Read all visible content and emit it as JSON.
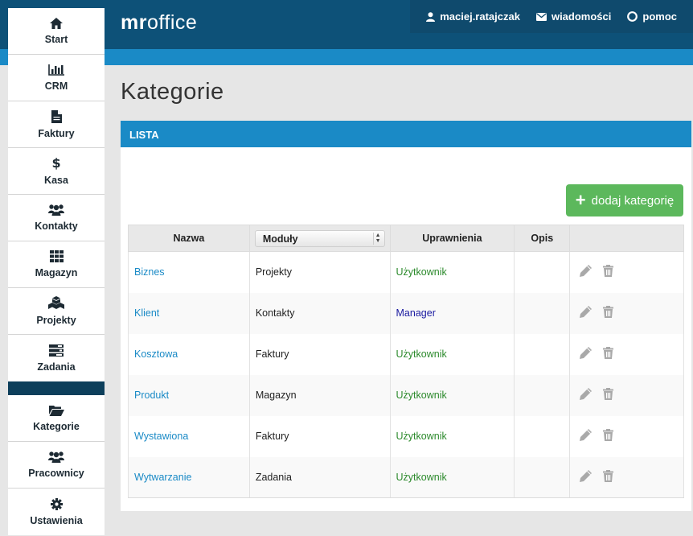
{
  "brand": {
    "bold": "mr",
    "rest": "office"
  },
  "usermenu": [
    {
      "label": "maciej.ratajczak",
      "icon": "user-icon"
    },
    {
      "label": "wiadomości",
      "icon": "envelope-icon"
    },
    {
      "label": "pomoc",
      "icon": "lifebuoy-icon"
    }
  ],
  "sidebar": {
    "items": [
      {
        "label": "Start",
        "icon": "home-icon"
      },
      {
        "label": "CRM",
        "icon": "bar-chart-icon"
      },
      {
        "label": "Faktury",
        "icon": "file-icon"
      },
      {
        "label": "Kasa",
        "icon": "dollar-icon"
      },
      {
        "label": "Kontakty",
        "icon": "group-icon"
      },
      {
        "label": "Magazyn",
        "icon": "grid-icon"
      },
      {
        "label": "Projekty",
        "icon": "cubes-icon"
      },
      {
        "label": "Zadania",
        "icon": "tasks-icon"
      }
    ],
    "bottom_items": [
      {
        "label": "Kategorie",
        "icon": "folder-open-icon"
      },
      {
        "label": "Pracownicy",
        "icon": "group-icon"
      },
      {
        "label": "Ustawienia",
        "icon": "gear-icon"
      }
    ]
  },
  "page": {
    "title": "Kategorie"
  },
  "panel": {
    "title": "LISTA",
    "add_button": "dodaj kategorię"
  },
  "table": {
    "headers": {
      "name": "Nazwa",
      "modules": "Moduły",
      "permissions": "Uprawnienia",
      "description": "Opis"
    },
    "rows": [
      {
        "name": "Biznes",
        "module": "Projekty",
        "permission": "Użytkownik",
        "description": ""
      },
      {
        "name": "Klient",
        "module": "Kontakty",
        "permission": "Manager",
        "description": ""
      },
      {
        "name": "Kosztowa",
        "module": "Faktury",
        "permission": "Użytkownik",
        "description": ""
      },
      {
        "name": "Produkt",
        "module": "Magazyn",
        "permission": "Użytkownik",
        "description": ""
      },
      {
        "name": "Wystawiona",
        "module": "Faktury",
        "permission": "Użytkownik",
        "description": ""
      },
      {
        "name": "Wytwarzanie",
        "module": "Zadania",
        "permission": "Użytkownik",
        "description": ""
      }
    ]
  },
  "colors": {
    "header_dark": "#0d5178",
    "header_light": "#1a8ac6",
    "success": "#5cb85c",
    "link": "#1a8ac6",
    "perm_user": "#2c8a2c",
    "perm_manager": "#1a1aa0"
  }
}
